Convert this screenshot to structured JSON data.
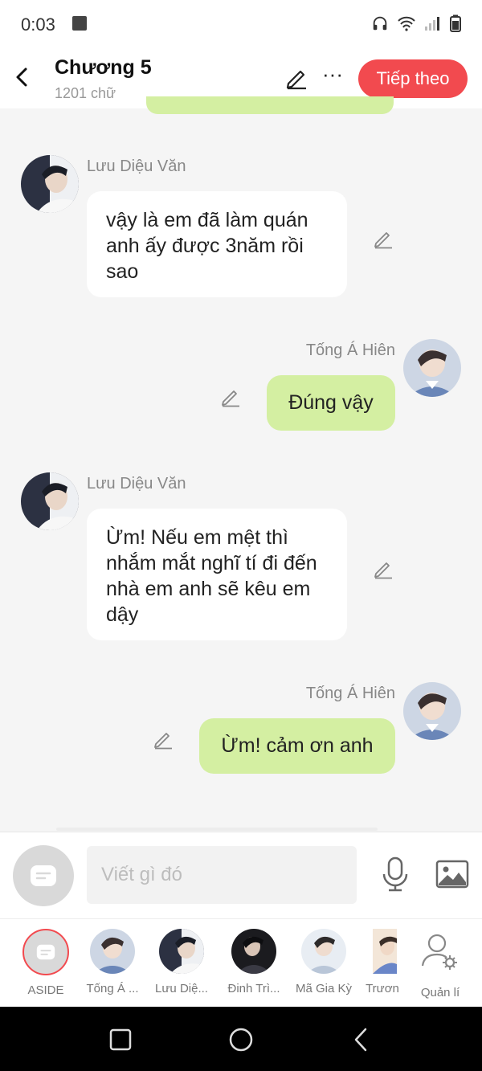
{
  "status": {
    "time": "0:03"
  },
  "header": {
    "title": "Chương 5",
    "word_count": "1201 chữ",
    "next_label": "Tiếp theo"
  },
  "messages": [
    {
      "side": "left",
      "sender": "Lưu Diệu Văn",
      "text": "vậy là em đã làm quán anh ấy được 3năm rồi sao"
    },
    {
      "side": "right",
      "sender": "Tống Á Hiên",
      "text": "Đúng vậy"
    },
    {
      "side": "left",
      "sender": "Lưu Diệu Văn",
      "text": "Ừm! Nếu em mệt thì nhắm mắt nghĩ tí đi đến nhà em anh sẽ kêu em dậy"
    },
    {
      "side": "right",
      "sender": "Tống Á Hiên",
      "text": "Ừm! cảm ơn anh"
    }
  ],
  "composer": {
    "placeholder": "Viết gì đó"
  },
  "characters": [
    {
      "label": "ASIDE"
    },
    {
      "label": "Tống Á ..."
    },
    {
      "label": "Lưu Diệ..."
    },
    {
      "label": "Đinh Trì..."
    },
    {
      "label": "Mã Gia Kỳ"
    },
    {
      "label": "Trươn"
    },
    {
      "label": "Quản lí"
    }
  ],
  "colors": {
    "accent": "#f24a4f",
    "bubble_right": "#d4efa2",
    "bubble_left": "#ffffff",
    "background": "#f5f5f5"
  },
  "icons": [
    "back-icon",
    "pencil-icon",
    "more-icon",
    "microphone-icon",
    "image-icon",
    "aside-chat-icon",
    "manage-user-icon",
    "recent-apps-icon",
    "home-icon",
    "nav-back-icon"
  ]
}
